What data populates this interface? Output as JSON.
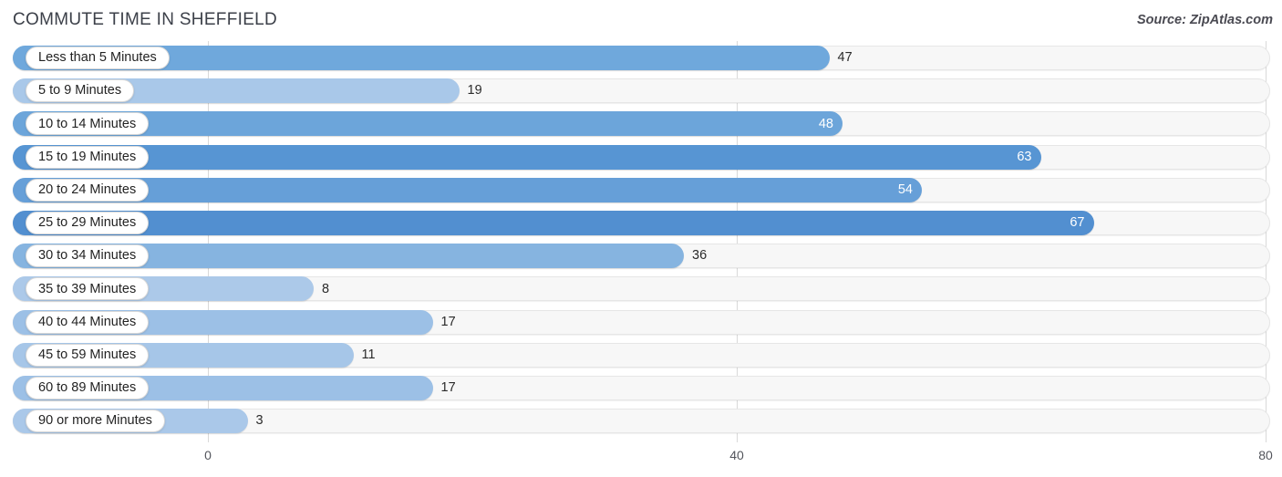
{
  "header": {
    "title": "COMMUTE TIME IN SHEFFIELD",
    "source": "Source: ZipAtlas.com"
  },
  "axis": {
    "ticks": [
      "0",
      "40",
      "80"
    ]
  },
  "chart_data": {
    "type": "bar",
    "orientation": "horizontal",
    "title": "COMMUTE TIME IN SHEFFIELD",
    "subtitle": "Source: ZipAtlas.com",
    "xlabel": "",
    "ylabel": "",
    "xlim": [
      0,
      80
    ],
    "xticks": [
      0,
      40,
      80
    ],
    "grid": true,
    "legend": "none",
    "categories": [
      "Less than 5 Minutes",
      "5 to 9 Minutes",
      "10 to 14 Minutes",
      "15 to 19 Minutes",
      "20 to 24 Minutes",
      "25 to 29 Minutes",
      "30 to 34 Minutes",
      "35 to 39 Minutes",
      "40 to 44 Minutes",
      "45 to 59 Minutes",
      "60 to 89 Minutes",
      "90 or more Minutes"
    ],
    "values": [
      47,
      19,
      48,
      63,
      54,
      67,
      36,
      8,
      17,
      11,
      17,
      3
    ],
    "bar_colors": [
      "#6fa8dc",
      "#a9c8e9",
      "#6ca5da",
      "#5795d3",
      "#669fd8",
      "#528fd0",
      "#86b4e0",
      "#acc9e9",
      "#9cc0e6",
      "#a6c6e8",
      "#9cc0e6",
      "#aac8e9"
    ],
    "label_inside": [
      false,
      false,
      true,
      true,
      true,
      true,
      false,
      false,
      false,
      false,
      false,
      false
    ]
  },
  "colors": {
    "track": "#f7f7f7",
    "track_border": "#e6e6e6",
    "gridline": "#d9d9d9",
    "title": "#3c4049",
    "value_outside": "#2b2b2b",
    "value_inside": "#ffffff"
  }
}
